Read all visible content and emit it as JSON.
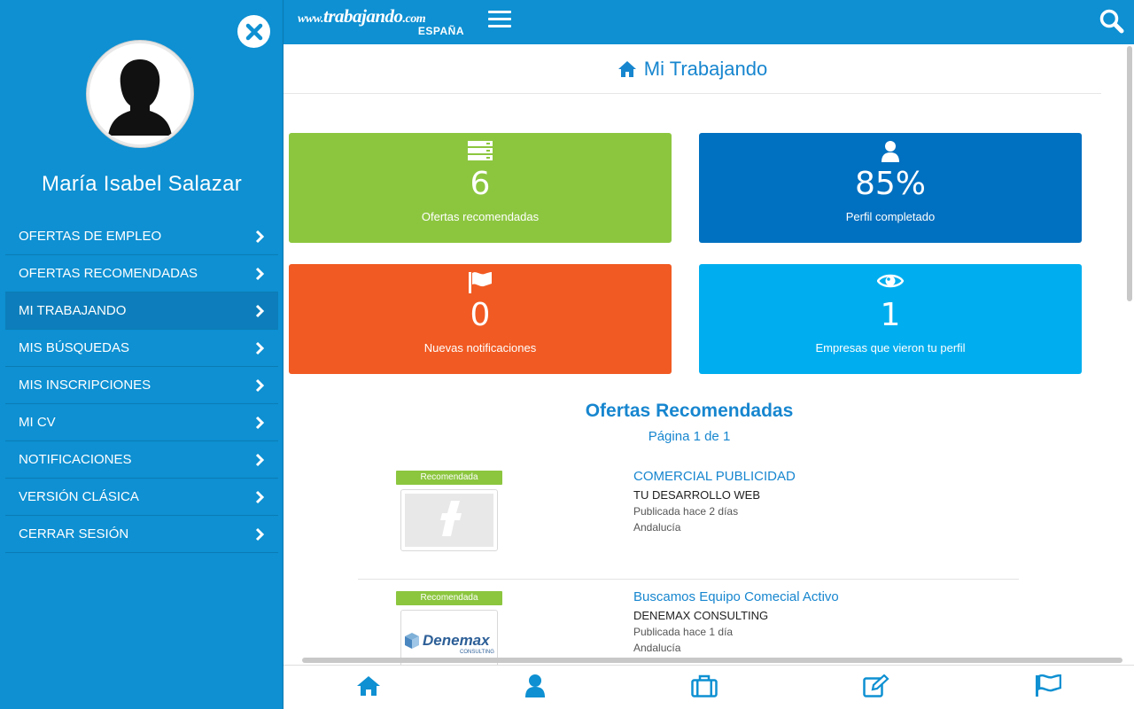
{
  "sidebar": {
    "user_name": "María Isabel Salazar",
    "menu": [
      {
        "label": "OFERTAS DE EMPLEO"
      },
      {
        "label": "OFERTAS RECOMENDADAS"
      },
      {
        "label": "MI TRABAJANDO",
        "active": true
      },
      {
        "label": "MIS BÚSQUEDAS"
      },
      {
        "label": "MIS INSCRIPCIONES"
      },
      {
        "label": "MI CV"
      },
      {
        "label": "NOTIFICACIONES"
      },
      {
        "label": "VERSIÓN CLÁSICA"
      },
      {
        "label": "CERRAR SESIÓN"
      }
    ]
  },
  "header": {
    "logo_text": "www.trabajando.com",
    "logo_www": "www.",
    "logo_brand": "trabajando",
    "logo_domain": ".com",
    "logo_country": "ESPAÑA"
  },
  "page": {
    "title": "Mi Trabajando"
  },
  "cards": {
    "recommended": {
      "value": "6",
      "label": "Ofertas recomendadas",
      "icon": "server-icon",
      "color": "#8cc63f"
    },
    "profile": {
      "value": "85%",
      "label": "Perfil completado",
      "icon": "user-icon",
      "color": "#0070c0"
    },
    "notifications": {
      "value": "0",
      "label": "Nuevas notificaciones",
      "icon": "flag-icon",
      "color": "#f15a22"
    },
    "views": {
      "value": "1",
      "label": "Empresas que vieron tu perfil",
      "icon": "eye-icon",
      "color": "#00aeef"
    }
  },
  "recommended": {
    "title": "Ofertas Recomendadas",
    "pagination": "Página 1 de 1",
    "jobs": [
      {
        "badge": "Recomendada",
        "title": "COMERCIAL PUBLICIDAD",
        "company": "TU DESARROLLO WEB",
        "posted": "Publicada hace 2 días",
        "location": "Andalucía",
        "logo": "placeholder-logo-icon"
      },
      {
        "badge": "Recomendada",
        "title": "Buscamos Equipo Comecial Activo",
        "company": "DENEMAX CONSULTING",
        "posted": "Publicada hace 1 día",
        "location": "Andalucía",
        "logo_text": "Denemax",
        "logo_sub": "CONSULTING"
      }
    ]
  },
  "bottom_nav": [
    "home-icon",
    "user-icon",
    "briefcase-icon",
    "edit-icon",
    "flag-icon"
  ],
  "colors": {
    "brand_blue": "#0e90d2",
    "link_blue": "#1786cf"
  }
}
